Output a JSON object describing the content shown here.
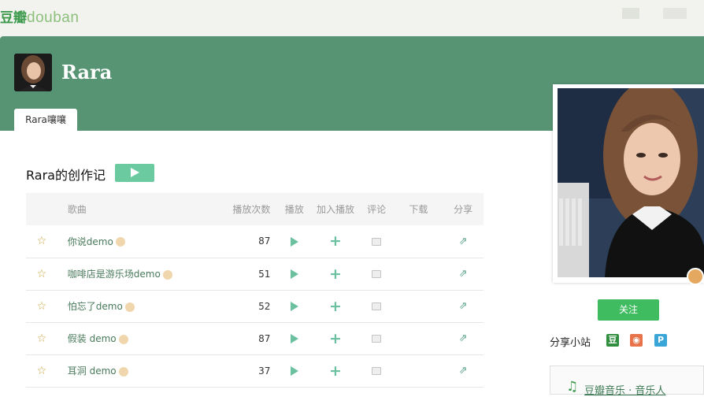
{
  "header": {
    "logo_cn": "豆瓣",
    "logo_en": "douban"
  },
  "artist": {
    "name": "Rara",
    "tab": "Rara嚷嚷"
  },
  "section": {
    "title": "Rara的创作记"
  },
  "table": {
    "headers": [
      "歌曲",
      "播放次数",
      "播放",
      "加入播放",
      "评论",
      "下载",
      "分享"
    ],
    "rows": [
      {
        "name": "你说demo",
        "plays": "87"
      },
      {
        "name": "咖啡店是游乐场demo",
        "plays": "51"
      },
      {
        "name": "怕忘了demo",
        "plays": "52"
      },
      {
        "name": "假装 demo",
        "plays": "87"
      },
      {
        "name": "耳洞 demo",
        "plays": "37"
      }
    ]
  },
  "sidebar": {
    "follow": "关注",
    "share_site": "分享小站",
    "bottom_link": "豆瓣音乐 · 音乐人"
  },
  "colors": {
    "brand_green": "#579474",
    "accent": "#6bcaa0",
    "follow": "#3fbb60"
  }
}
